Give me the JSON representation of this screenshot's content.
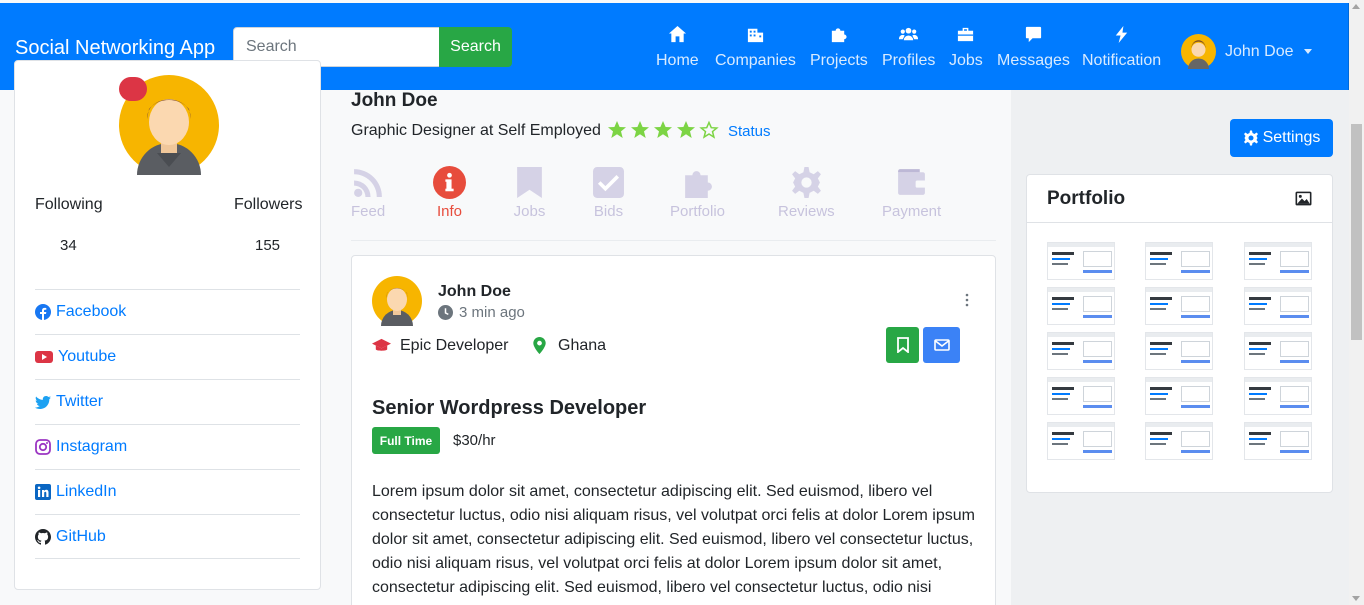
{
  "navbar": {
    "brand": "Social Networking App",
    "search_placeholder": "Search",
    "search_button": "Search",
    "items": [
      {
        "label": "Home",
        "icon": "home-icon"
      },
      {
        "label": "Companies",
        "icon": "building-icon"
      },
      {
        "label": "Projects",
        "icon": "puzzle-icon"
      },
      {
        "label": "Profiles",
        "icon": "users-icon"
      },
      {
        "label": "Jobs",
        "icon": "briefcase-icon"
      },
      {
        "label": "Messages",
        "icon": "comment-icon"
      },
      {
        "label": "Notification",
        "icon": "bolt-icon"
      }
    ],
    "user_name": "John Doe"
  },
  "left": {
    "following_label": "Following",
    "followers_label": "Followers",
    "following_count": "34",
    "followers_count": "155",
    "socials": [
      {
        "label": "Facebook",
        "icon": "facebook-icon",
        "color": "#1877f2"
      },
      {
        "label": "Youtube",
        "icon": "youtube-icon",
        "color": "#dc3545"
      },
      {
        "label": "Twitter",
        "icon": "twitter-icon",
        "color": "#1da1f2"
      },
      {
        "label": "Instagram",
        "icon": "instagram-icon",
        "color": "#9b35c2"
      },
      {
        "label": "LinkedIn",
        "icon": "linkedin-icon",
        "color": "#0a66c2"
      },
      {
        "label": "GitHub",
        "icon": "github-icon",
        "color": "#212529"
      }
    ]
  },
  "profile": {
    "name": "John Doe",
    "title": "Graphic Designer at Self Employed",
    "rating": 4,
    "rating_max": 5,
    "status_link": "Status"
  },
  "tabs": [
    {
      "label": "Feed",
      "icon": "rss-icon",
      "active": false
    },
    {
      "label": "Info",
      "icon": "info-icon",
      "active": true
    },
    {
      "label": "Jobs",
      "icon": "bookmark-icon",
      "active": false
    },
    {
      "label": "Bids",
      "icon": "check-square-icon",
      "active": false
    },
    {
      "label": "Portfolio",
      "icon": "puzzle-icon",
      "active": false
    },
    {
      "label": "Reviews",
      "icon": "cog-icon",
      "active": false
    },
    {
      "label": "Payment",
      "icon": "wallet-icon",
      "active": false
    }
  ],
  "post": {
    "author": "John Doe",
    "time": "3 min ago",
    "badge": "Epic Developer",
    "location": "Ghana",
    "job_title": "Senior Wordpress Developer",
    "job_type": "Full Time",
    "rate": "$30/hr",
    "description": "Lorem ipsum dolor sit amet, consectetur adipiscing elit. Sed euismod, libero vel consectetur luctus, odio nisi aliquam risus, vel volutpat orci felis at dolor Lorem ipsum dolor sit amet, consectetur adipiscing elit. Sed euismod, libero vel consectetur luctus, odio nisi aliquam risus, vel volutpat orci felis at dolor Lorem ipsum dolor sit amet, consectetur adipiscing elit. Sed euismod, libero vel consectetur luctus, odio nisi"
  },
  "right": {
    "settings_button": "Settings",
    "portfolio_title": "Portfolio",
    "thumbnail_count": 15
  },
  "colors": {
    "primary": "#007bff",
    "success": "#28a745",
    "danger": "#dc3545",
    "star": "#7cd444",
    "tab_active": "#e74c3c"
  }
}
